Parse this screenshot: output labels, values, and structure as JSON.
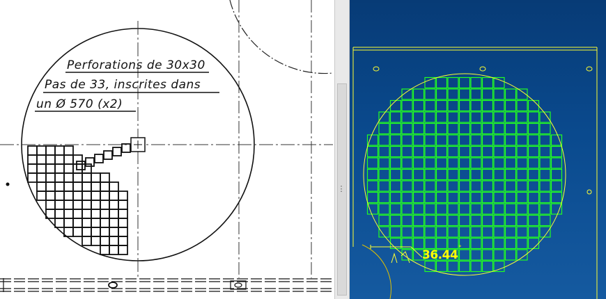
{
  "drawing_note": {
    "line1": "Perforations de 30x30",
    "line2": "Pas de 33, inscrites dans",
    "line3": "un Ø 570 (x2)"
  },
  "cad_view": {
    "dimension_value": "36.44",
    "dimension_unit_mark": "°",
    "grid_color": "#00ff00",
    "outline_color": "#ffff00",
    "background_color": "#0a4a8e"
  },
  "splitter": {
    "grip_glyph": "⋮"
  }
}
